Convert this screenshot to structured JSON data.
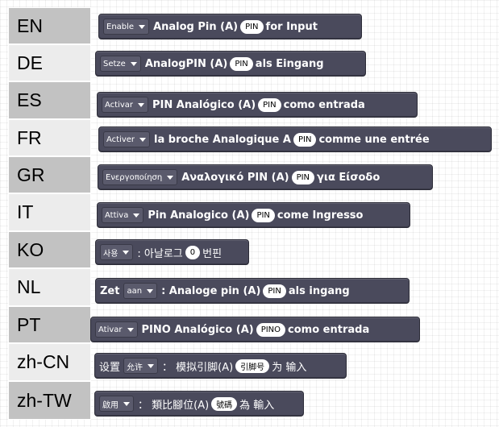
{
  "languages": [
    "EN",
    "DE",
    "ES",
    "FR",
    "GR",
    "IT",
    "KO",
    "NL",
    "PT",
    "zh-CN",
    "zh-TW"
  ],
  "rows": [
    {
      "dropdown": "Enable",
      "pre": "",
      "mid": "Analog Pin (A)",
      "pill": "PIN",
      "post": "for Input"
    },
    {
      "dropdown": "Setze",
      "pre": "",
      "mid": "AnalogPIN (A)",
      "pill": "PIN",
      "post": "als Eingang"
    },
    {
      "dropdown": "Activar",
      "pre": "",
      "mid": "PIN Analógico (A)",
      "pill": "PIN",
      "post": "como entrada"
    },
    {
      "dropdown": "Activer",
      "pre": "",
      "mid": "la broche Analogique A",
      "pill": "PIN",
      "post": "comme une entrée"
    },
    {
      "dropdown": "Ενεργοποίηση",
      "pre": "",
      "mid": "Αναλογικό PIN (A)",
      "pill": "PIN",
      "post": "για Είσοδο"
    },
    {
      "dropdown": "Attiva",
      "pre": "",
      "mid": "Pin Analogico (A)",
      "pill": "PIN",
      "post": "come Ingresso"
    },
    {
      "dropdown": "사용",
      "pre": "",
      "mid": ": 아날로그",
      "pill": "0",
      "post": "번핀"
    },
    {
      "dropdown": "aan",
      "pre": "Zet",
      "mid": ": Analoge pin (A)",
      "pill": "PIN",
      "post": "als ingang"
    },
    {
      "dropdown": "Ativar",
      "pre": "",
      "mid": "PINO Analógico (A)",
      "pill": "PINO",
      "post": "como entrada"
    },
    {
      "dropdown": "允许",
      "pre": "设置",
      "mid": "： 模拟引脚(A)",
      "pill": "引脚号",
      "post": "为 输入"
    },
    {
      "dropdown": "啟用",
      "pre": "",
      "mid": "： 類比腳位(A)",
      "pill": "號碼",
      "post": "為 輸入"
    }
  ]
}
